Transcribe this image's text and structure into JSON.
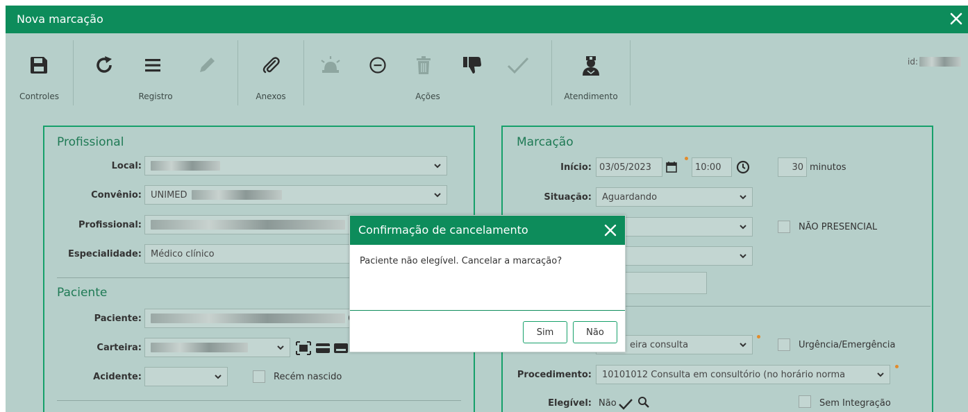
{
  "window": {
    "title": "Nova marcação"
  },
  "toolbar": {
    "groups": {
      "controles": "Controles",
      "registro": "Registro",
      "anexos": "Anexos",
      "acoes": "Ações",
      "atendimento": "Atendimento"
    },
    "id_label": "id:"
  },
  "profissional": {
    "title": "Profissional",
    "local_label": "Local:",
    "convenio_label": "Convênio:",
    "convenio_value": "UNIMED",
    "profissional_label": "Profissional:",
    "especialidade_label": "Especialidade:",
    "especialidade_value": "Médico clínico"
  },
  "paciente": {
    "title": "Paciente",
    "paciente_label": "Paciente:",
    "paciente_value_fragment": "6",
    "carteira_label": "Carteira:",
    "acidente_label": "Acidente:",
    "recem_nascido_label": "Recém nascido"
  },
  "marcacao": {
    "title": "Marcação",
    "inicio_label": "Início:",
    "date_value": "03/05/2023",
    "time_value": "10:00",
    "duration_value": "30",
    "duration_unit": "minutos",
    "situacao_label": "Situação:",
    "situacao_value": "Aguardando",
    "nao_presencial_label": "NÃO PRESENCIAL",
    "tipo_value_fragment": "eira consulta",
    "urgencia_label": "Urgência/Emergência",
    "procedimento_label": "Procedimento:",
    "procedimento_value": "10101012 Consulta em consultório (no horário norma",
    "elegivel_label": "Elegível:",
    "elegivel_value": "Não",
    "sem_integracao_label": "Sem Integração"
  },
  "modal": {
    "title": "Confirmação de cancelamento",
    "message": "Paciente não elegível. Cancelar a marcação?",
    "yes_label": "Sim",
    "no_label": "Não"
  },
  "colors": {
    "brand_green": "#0d8c5b",
    "panel_border": "#16a06a",
    "background": "#b6cfca",
    "required_dot": "#e28b2b"
  },
  "icons": [
    "save-icon",
    "refresh-icon",
    "list-icon",
    "edit-icon",
    "paperclip-icon",
    "alarm-icon",
    "minus-circle-icon",
    "trash-icon",
    "thumbs-down-icon",
    "check-icon",
    "doctor-icon",
    "close-icon",
    "calendar-icon",
    "clock-icon",
    "chevron-down-icon",
    "barcode-icon",
    "card-icon",
    "search-icon"
  ]
}
